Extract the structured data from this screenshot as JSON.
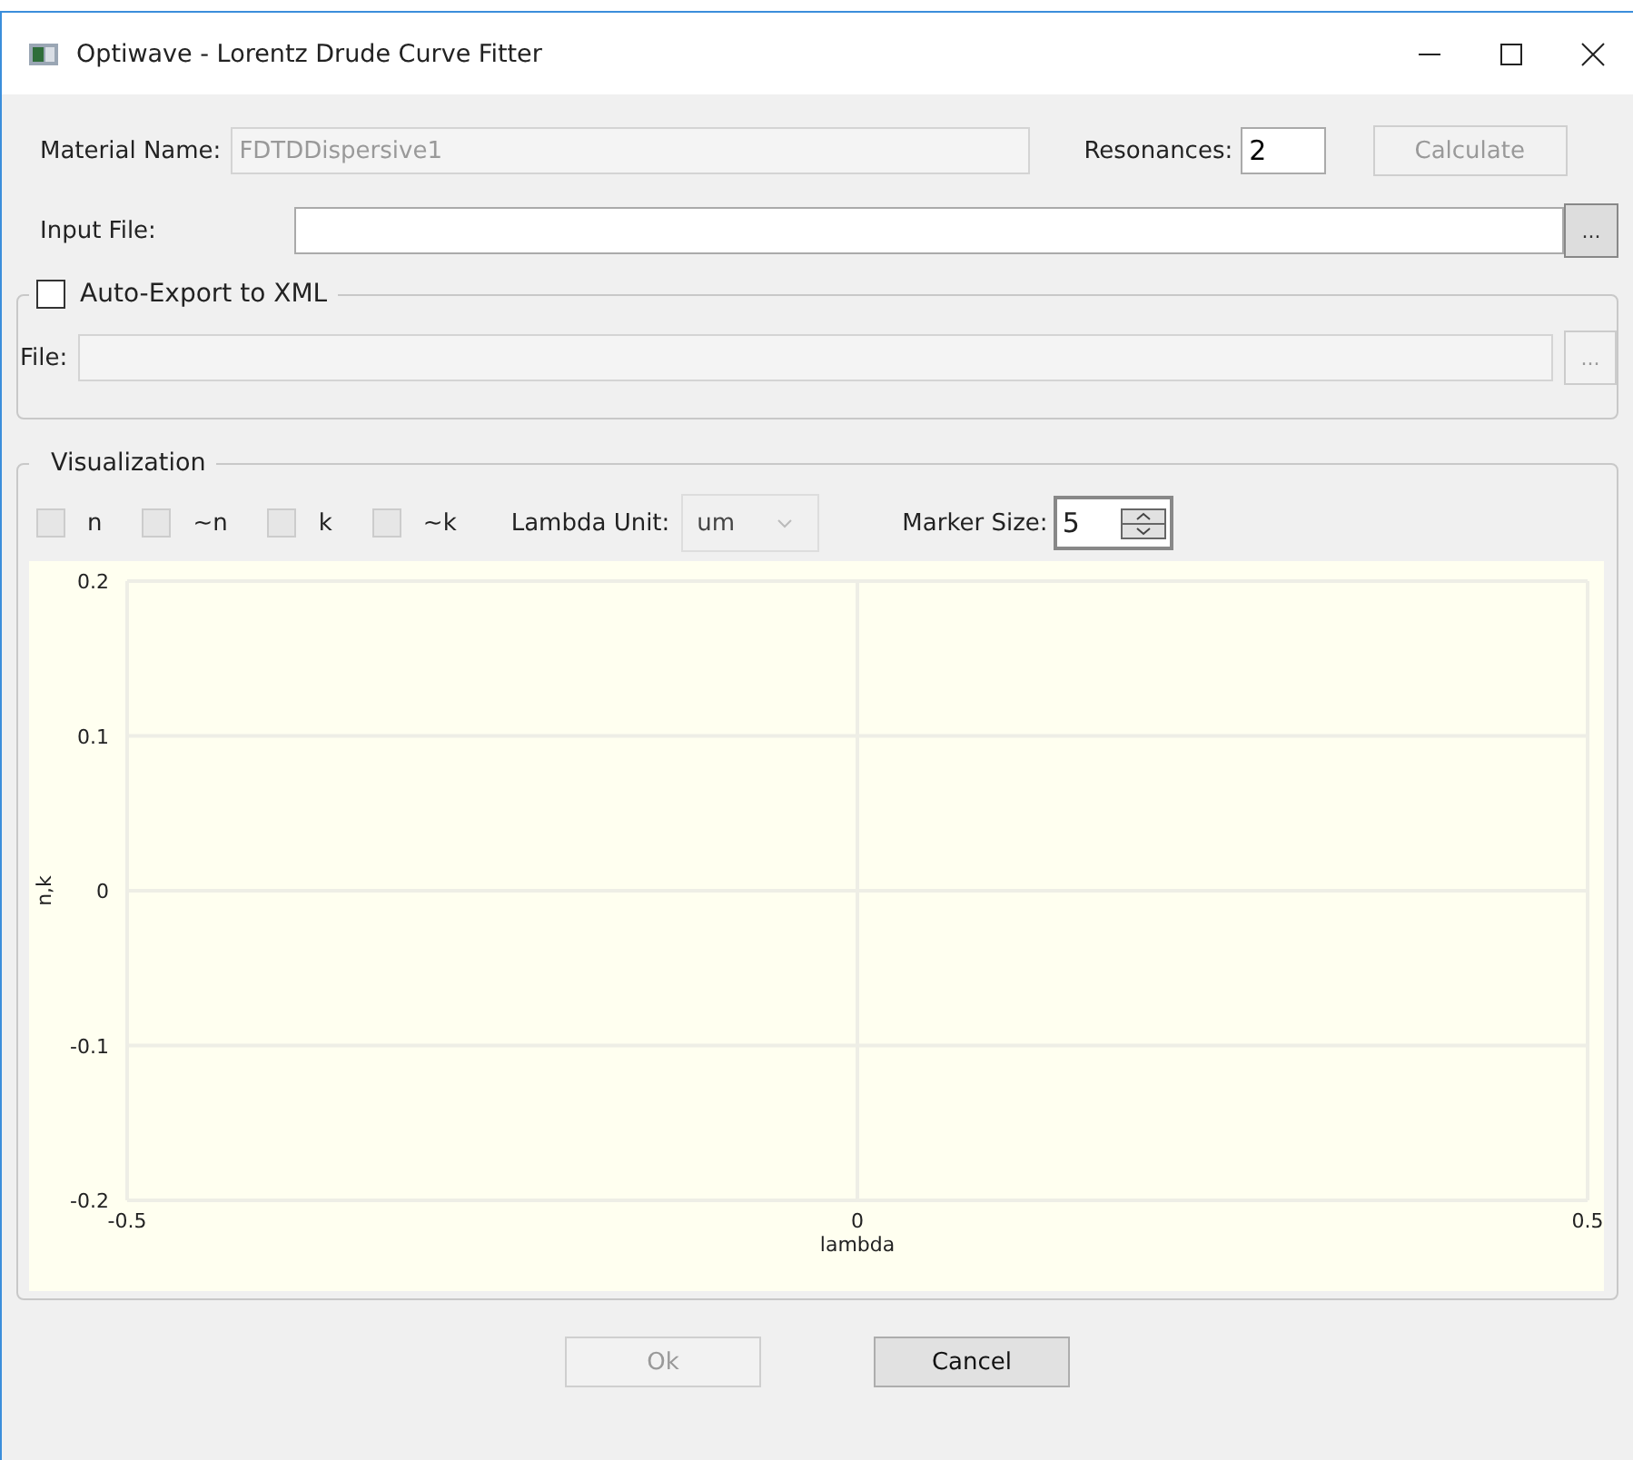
{
  "window": {
    "title": "Optiwave - Lorentz Drude Curve Fitter"
  },
  "material": {
    "label": "Material Name:",
    "value": "FDTDDispersive1",
    "disabled": true
  },
  "resonances": {
    "label": "Resonances:",
    "value": "2"
  },
  "calculate": {
    "label": "Calculate",
    "disabled": true
  },
  "input_file": {
    "label": "Input File:",
    "browse": "...",
    "disabled": false
  },
  "auto_export": {
    "label": "Auto-Export to XML",
    "checked": false,
    "file_label": "File:",
    "browse": "...",
    "disabled": true
  },
  "visualization": {
    "title": "Visualization",
    "checkboxes": [
      {
        "label": "n",
        "checked": false,
        "disabled": true
      },
      {
        "label": "~n",
        "checked": false,
        "disabled": true
      },
      {
        "label": "k",
        "checked": false,
        "disabled": true
      },
      {
        "label": "~k",
        "checked": false,
        "disabled": true
      }
    ],
    "lambda_unit": {
      "label": "Lambda Unit:",
      "value": "um",
      "disabled": true
    },
    "marker_size": {
      "label": "Marker Size:",
      "value": "5"
    },
    "chart_data": {
      "type": "line",
      "grid": true,
      "xlabel": "lambda",
      "ylabel": "n,k",
      "xlim": [
        -0.5,
        0.5
      ],
      "ylim": [
        -0.2,
        0.2
      ],
      "xticks": [
        -0.5,
        0,
        0.5
      ],
      "yticks": [
        -0.2,
        -0.1,
        0,
        0.1,
        0.2
      ]
    }
  },
  "buttons": [
    {
      "label": "Ok",
      "disabled": true
    },
    {
      "label": "Cancel",
      "disabled": false
    }
  ]
}
